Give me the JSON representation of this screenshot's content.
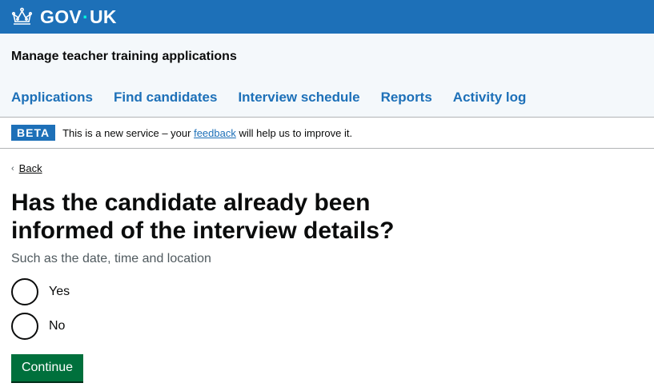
{
  "header": {
    "logo_text_left": "GOV",
    "logo_dot": "·",
    "logo_text_right": "UK",
    "logo_icon": "crown-icon",
    "colors": {
      "header_bg": "#1d70b8",
      "dot": "#00ffe0"
    }
  },
  "service": {
    "name": "Manage teacher training applications"
  },
  "nav": {
    "items": [
      {
        "label": "Applications"
      },
      {
        "label": "Find candidates"
      },
      {
        "label": "Interview schedule"
      },
      {
        "label": "Reports"
      },
      {
        "label": "Activity log"
      }
    ]
  },
  "phase": {
    "tag": "BETA",
    "text_before": "This is a new service – your ",
    "link": "feedback",
    "text_after": " will help us to improve it."
  },
  "back": {
    "chevron": "‹",
    "label": "Back"
  },
  "question": {
    "heading": "Has the candidate already been informed of the interview details?",
    "hint": "Such as the date, time and location",
    "options": [
      {
        "label": "Yes"
      },
      {
        "label": "No"
      }
    ]
  },
  "actions": {
    "continue_label": "Continue",
    "colors": {
      "button_bg": "#00703c"
    }
  }
}
